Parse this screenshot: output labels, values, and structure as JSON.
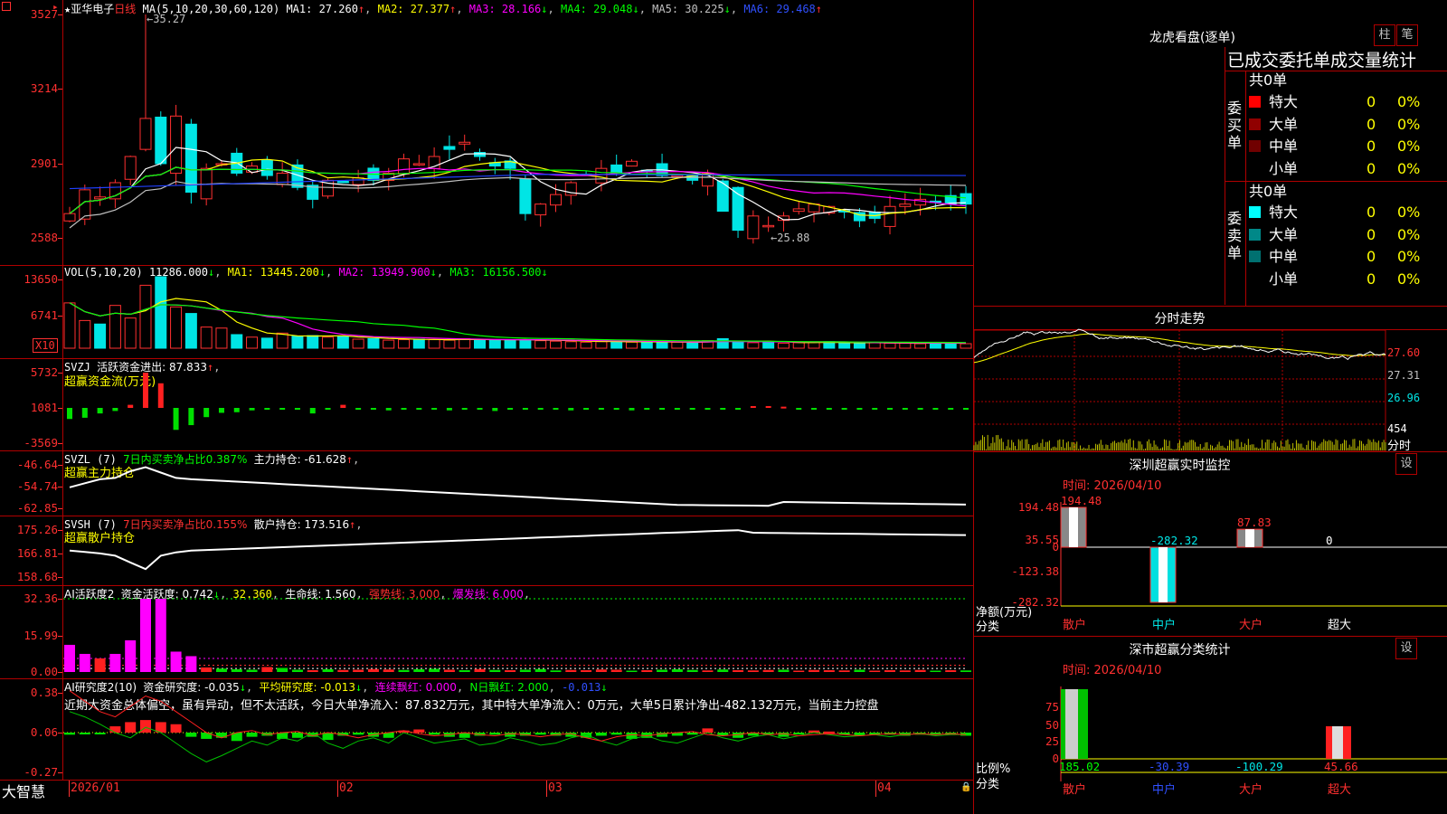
{
  "stock": {
    "name": "亚华电子",
    "star": "★",
    "period": "日线"
  },
  "colors": {
    "up": "#ff3030",
    "down": "#00e5e5",
    "ma1": "#ffffff",
    "ma2": "#ffff00",
    "ma3": "#ff00ff",
    "ma4": "#00ff00",
    "ma5": "#c0c0c0",
    "ma6": "#0000ff",
    "axis": "#b00000",
    "label": "#ff3030"
  },
  "main_panel": {
    "y_labels": [
      "3527",
      "3214",
      "2901",
      "2588"
    ],
    "ma_text": {
      "params": "MA(5,10,20,30,60,120)",
      "ma1": "MA1: 27.260",
      "ma1_arrow": "↑",
      "ma2": "MA2: 27.377",
      "ma2_arrow": "↑",
      "ma3": "MA3: 28.166",
      "ma3_arrow": "↓",
      "ma4": "MA4: 29.048",
      "ma4_arrow": "↓",
      "ma5": "MA5: 30.225",
      "ma5_arrow": "↓",
      "ma6": "MA6: 29.468",
      "ma6_arrow": "↑"
    },
    "high_label": "35.27",
    "low_label": "25.88"
  },
  "vol_panel": {
    "y_labels": [
      "13650",
      "6741"
    ],
    "unit_label": "X10",
    "title": "VOL(5,10,20)",
    "value": "11286.000",
    "value_arrow": "↓",
    "ma1": "MA1: 13445.200",
    "ma1_arrow": "↓",
    "ma2": "MA2: 13949.900",
    "ma2_arrow": "↓",
    "ma3": "MA3: 16156.500",
    "ma3_arrow": "↓"
  },
  "svzj_panel": {
    "y_labels": [
      "5732",
      "1081",
      "-3569"
    ],
    "title": "SVZJ",
    "metric": "活跃资金进出: 87.833",
    "metric_arrow": "↑",
    "sub": "超赢资金流(万元)"
  },
  "svzl_panel": {
    "y_labels": [
      "-46.64",
      "-54.74",
      "-62.85"
    ],
    "title": "SVZL (7)",
    "ratio": "7日内买卖净占比0.387%",
    "hold": "主力持仓: -61.628",
    "hold_arrow": "↑",
    "sub": "超赢主力持仓"
  },
  "svsh_panel": {
    "y_labels": [
      "175.26",
      "166.81",
      "158.68"
    ],
    "title": "SVSH (7)",
    "ratio": "7日内买卖净占比0.155%",
    "hold": "散户持仓: 173.516",
    "hold_arrow": "↑",
    "sub": "超赢散户持仓"
  },
  "ai_active_panel": {
    "y_labels": [
      "32.36",
      "15.99",
      "0.00"
    ],
    "title": "AI活跃度2",
    "degree": "资金活跃度: 0.742",
    "degree_arrow": "↓",
    "v2": "32.360",
    "life": "生命线: 1.560",
    "strong": "强势线: 3.000",
    "burst": "爆发线: 6.000"
  },
  "ai_research_panel": {
    "y_labels": [
      "0.38",
      "0.06",
      "-0.27"
    ],
    "title": "AI研究度2(10)",
    "degree": "资金研究度: -0.035",
    "degree_arrow": "↓",
    "avg": "平均研究度: -0.013",
    "avg_arrow": "↓",
    "red": "连续飘红: 0.000",
    "nred": "N日飘红: 2.000",
    "v5": "-0.013",
    "v5_arrow": "↓",
    "commentary": "近期大资金总体偏空，虽有异动，但不太活跃，今日大单净流入：87.832万元，其中特大单净流入：0万元，大单5日累计净出-482.132万元，当前主力控盘"
  },
  "x_axis": {
    "labels": [
      "2026/01",
      "02",
      "03",
      "04"
    ]
  },
  "footer": {
    "brand": "大智慧"
  },
  "dragon_tiger": {
    "title": "龙虎看盘(逐单)",
    "btn1": "柱",
    "btn2": "笔",
    "subtitle": "已成交委托单成交量统计",
    "buy": {
      "label": [
        "委",
        "买",
        "单"
      ],
      "total": "共0单",
      "rows": [
        {
          "name": "特大",
          "count": "0",
          "pct": "0%",
          "color": "#ff0000"
        },
        {
          "name": "大单",
          "count": "0",
          "pct": "0%",
          "color": "#900000"
        },
        {
          "name": "中单",
          "count": "0",
          "pct": "0%",
          "color": "#700000"
        },
        {
          "name": "小单",
          "count": "0",
          "pct": "0%",
          "color": "#000000"
        }
      ]
    },
    "sell": {
      "label": [
        "委",
        "卖",
        "单"
      ],
      "total": "共0单",
      "rows": [
        {
          "name": "特大",
          "count": "0",
          "pct": "0%",
          "color": "#00ffff"
        },
        {
          "name": "大单",
          "count": "0",
          "pct": "0%",
          "color": "#008888"
        },
        {
          "name": "中单",
          "count": "0",
          "pct": "0%",
          "color": "#007070"
        },
        {
          "name": "小单",
          "count": "0",
          "pct": "0%",
          "color": "#000000"
        }
      ]
    }
  },
  "intraday": {
    "title": "分时走势",
    "y_labels": [
      "27.60",
      "27.31",
      "26.96"
    ],
    "vol_label": "454",
    "vol_unit": "分时"
  },
  "sz_monitor": {
    "title": "深圳超赢实时监控",
    "btn": "设",
    "time": "时间: 2026/04/10",
    "y_labels": [
      "194.48",
      "35.55",
      "0",
      "-123.38",
      "-282.32"
    ],
    "y_title": "净额(万元)",
    "x_title": "分类",
    "categories": [
      "散户",
      "中户",
      "大户",
      "超大"
    ],
    "values": [
      194.48,
      -282.32,
      87.83,
      0
    ],
    "value_labels": [
      "194.48",
      "-282.32",
      "87.83",
      "0"
    ]
  },
  "sz_class": {
    "title": "深市超赢分类统计",
    "btn": "设",
    "time": "时间: 2026/04/10",
    "y_labels": [
      "75",
      "50",
      "25",
      "0"
    ],
    "y_title": "比例%",
    "x_title": "分类",
    "categories": [
      "散户",
      "中户",
      "大户",
      "超大"
    ],
    "value_labels": [
      "185.02",
      "-30.39",
      "-100.29",
      "45.66"
    ],
    "values": [
      185.02,
      -30.39,
      -100.29,
      45.66
    ]
  },
  "chart_data": [
    {
      "type": "candlestick",
      "title": "亚华电子 日线",
      "ylim": [
        25.88,
        35.27
      ],
      "note": "daily K-line, prices in yuan (axis labels shown ×100)",
      "x": [
        "2026/01",
        "02",
        "03",
        "04"
      ],
      "series": [
        {
          "name": "MA1",
          "values": [
            27.26
          ]
        },
        {
          "name": "MA2",
          "values": [
            27.377
          ]
        },
        {
          "name": "MA3",
          "values": [
            28.166
          ]
        },
        {
          "name": "MA4",
          "values": [
            29.048
          ]
        },
        {
          "name": "MA5",
          "values": [
            30.225
          ]
        },
        {
          "name": "MA6",
          "values": [
            29.468
          ]
        }
      ]
    },
    {
      "type": "bar",
      "title": "VOL(5,10,20)",
      "ylim": [
        0,
        13650
      ],
      "series": [
        {
          "name": "VOL",
          "values": [
            11286.0
          ]
        },
        {
          "name": "MA1",
          "values": [
            13445.2
          ]
        },
        {
          "name": "MA2",
          "values": [
            13949.9
          ]
        },
        {
          "name": "MA3",
          "values": [
            16156.5
          ]
        }
      ]
    },
    {
      "type": "bar",
      "title": "深圳超赢实时监控",
      "categories": [
        "散户",
        "中户",
        "大户",
        "超大"
      ],
      "values": [
        194.48,
        -282.32,
        87.83,
        0
      ],
      "ylabel": "净额(万元)",
      "ylim": [
        -282.32,
        194.48
      ]
    },
    {
      "type": "bar",
      "title": "深市超赢分类统计",
      "categories": [
        "散户",
        "中户",
        "大户",
        "超大"
      ],
      "values": [
        185.02,
        -30.39,
        -100.29,
        45.66
      ],
      "ylabel": "比例%",
      "ylim": [
        0,
        75
      ]
    }
  ]
}
